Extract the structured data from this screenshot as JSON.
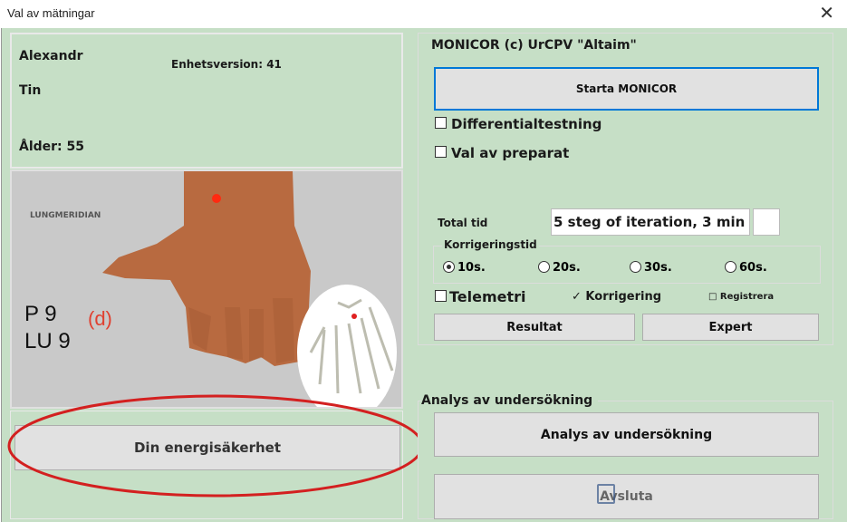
{
  "window": {
    "title": "Val av mätningar",
    "close": "✕"
  },
  "patient": {
    "first_name": "Alexandr",
    "last_name": "Tin",
    "version": "Enhetsversion: 41",
    "age": "Ålder: 55"
  },
  "image": {
    "meridian": "LUNGMERIDIAN",
    "point1": "P 9",
    "point_side": "(d)",
    "point2": "LU 9"
  },
  "energy_button": "Din energisäkerhet",
  "monicor": {
    "title": "MONICOR (c) UrCPV \"Altaim\"",
    "start": "Starta MONICOR",
    "differential": "Differentialtestning",
    "preparat": "Val av preparat",
    "total_label": "Total tid",
    "total_value": "5 steg of iteration, 3 min",
    "korr_label": "Korrigeringstid",
    "radios": [
      "10s.",
      "20s.",
      "30s.",
      "60s."
    ],
    "telemetri": "Telemetri",
    "korrigering": "✓ Korrigering",
    "registrera": "□ Registrera",
    "resultat": "Resultat",
    "expert": "Expert"
  },
  "analys": {
    "label": "Analys av undersökning",
    "button": "Analys av undersökning"
  },
  "avsluta": "Avsluta",
  "colors": {
    "panel": "#c6dfc6",
    "accent_red": "#d32020",
    "button_focus": "#0078d7"
  }
}
